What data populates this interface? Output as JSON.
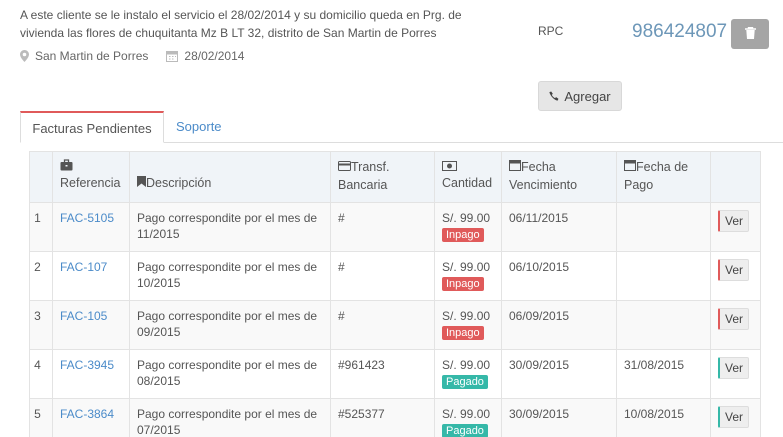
{
  "client": {
    "description": "A este cliente se le instalo el servicio el 28/02/2014 y su domicilio queda en Prg. de vivienda las flores de chuquitanta Mz B LT 32, distrito de San Martin de Porres",
    "location": "San Martin de Porres",
    "date": "28/02/2014"
  },
  "phone": {
    "label": "RPC",
    "number": "986424807",
    "add_label": "Agregar"
  },
  "tabs": [
    {
      "label": "Facturas Pendientes",
      "active": true
    },
    {
      "label": "Soporte",
      "active": false
    }
  ],
  "table": {
    "headers": {
      "referencia": "Referencia",
      "descripcion": "Descripción",
      "transf": "Transf. Bancaria",
      "cantidad": "Cantidad",
      "vencimiento": "Fecha Vencimiento",
      "pago": "Fecha de Pago"
    },
    "rows": [
      {
        "n": "1",
        "ref": "FAC-5105",
        "desc": "Pago correspondite por el mes de 11/2015",
        "transf": "#",
        "amount": "S/. 99.00",
        "status": "Inpago",
        "due": "06/11/2015",
        "paid": "",
        "action": "Ver"
      },
      {
        "n": "2",
        "ref": "FAC-107",
        "desc": "Pago correspondite por el mes de 10/2015",
        "transf": "#",
        "amount": "S/. 99.00",
        "status": "Inpago",
        "due": "06/10/2015",
        "paid": "",
        "action": "Ver"
      },
      {
        "n": "3",
        "ref": "FAC-105",
        "desc": "Pago correspondite por el mes de 09/2015",
        "transf": "#",
        "amount": "S/. 99.00",
        "status": "Inpago",
        "due": "06/09/2015",
        "paid": "",
        "action": "Ver"
      },
      {
        "n": "4",
        "ref": "FAC-3945",
        "desc": "Pago correspondite por el mes de 08/2015",
        "transf": "#961423",
        "amount": "S/. 99.00",
        "status": "Pagado",
        "due": "30/09/2015",
        "paid": "31/08/2015",
        "action": "Ver"
      },
      {
        "n": "5",
        "ref": "FAC-3864",
        "desc": "Pago correspondite por el mes de 07/2015",
        "transf": "#525377",
        "amount": "S/. 99.00",
        "status": "Pagado",
        "due": "30/09/2015",
        "paid": "10/08/2015",
        "action": "Ver"
      }
    ]
  },
  "icons": {
    "location": "map-marker-icon",
    "date": "calendar-icon",
    "delete": "trash-icon",
    "phone": "phone-icon",
    "referencia": "briefcase-icon",
    "descripcion": "bookmark-icon",
    "transf": "credit-card-icon",
    "cantidad": "money-icon",
    "vencimiento": "calendar-icon",
    "pago": "calendar-icon"
  },
  "colors": {
    "accent_red": "#e05a5a",
    "accent_green": "#35b8a8",
    "link": "#4b8bc9",
    "phone_number": "#6d97b8"
  }
}
